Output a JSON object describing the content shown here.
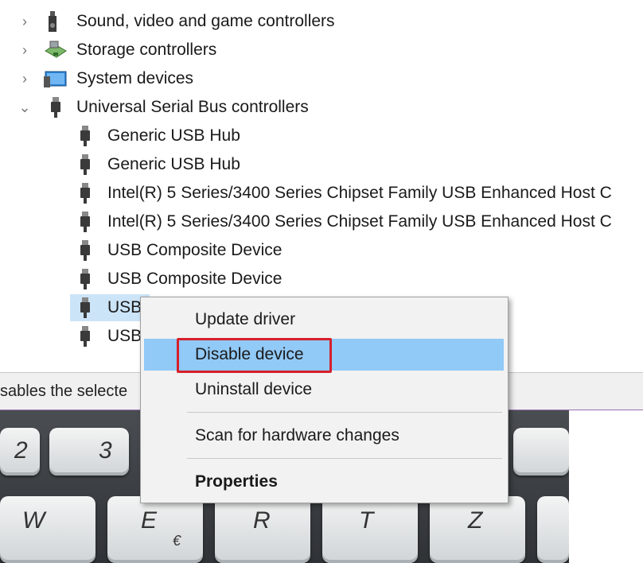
{
  "tree": {
    "categories": [
      {
        "label": "Sound, video and game controllers",
        "icon": "speaker-icon"
      },
      {
        "label": "Storage controllers",
        "icon": "storage-controller-icon"
      },
      {
        "label": "System devices",
        "icon": "system-devices-icon"
      },
      {
        "label": "Universal Serial Bus controllers",
        "icon": "usb-plug-icon"
      }
    ],
    "usb_children": [
      "Generic USB Hub",
      "Generic USB Hub",
      "Intel(R) 5 Series/3400 Series Chipset Family USB Enhanced Host C",
      "Intel(R) 5 Series/3400 Series Chipset Family USB Enhanced Host C",
      "USB Composite Device",
      "USB Composite Device",
      "USB",
      "USB"
    ]
  },
  "status_bar": {
    "text": "sables the selecte"
  },
  "context_menu": {
    "items": [
      "Update driver",
      "Disable device",
      "Uninstall device",
      "Scan for hardware changes",
      "Properties"
    ],
    "highlighted": "Disable device"
  },
  "keyboard": {
    "keys": [
      "2",
      "3",
      "W",
      "E",
      "€",
      "R",
      "T",
      "Z"
    ]
  },
  "colors": {
    "menu_highlight": "#91c9f7",
    "annotation_box": "#d6202a",
    "selection": "#cce4f7"
  }
}
